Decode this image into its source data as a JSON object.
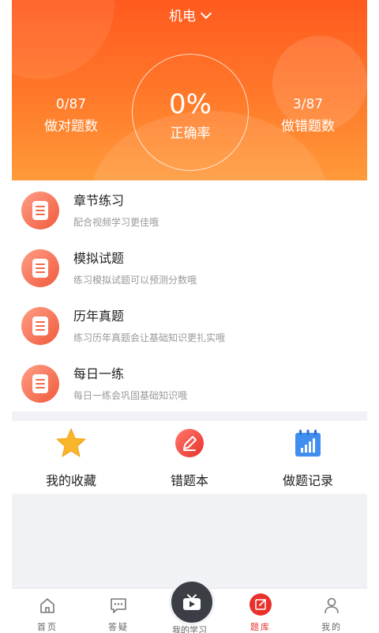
{
  "header": {
    "subject": "机电",
    "correct_count": "0/87",
    "correct_label": "做对题数",
    "accuracy_value": "0%",
    "accuracy_label": "正确率",
    "wrong_count": "3/87",
    "wrong_label": "做错题数"
  },
  "practice": {
    "items": [
      {
        "title": "章节练习",
        "subtitle": "配合视频学习更佳哦"
      },
      {
        "title": "模拟试题",
        "subtitle": "练习模拟试题可以预测分数哦"
      },
      {
        "title": "历年真题",
        "subtitle": "练习历年真题会让基础知识更扎实哦"
      },
      {
        "title": "每日一练",
        "subtitle": "每日一练会巩固基础知识哦"
      }
    ]
  },
  "tools": {
    "items": [
      {
        "label": "我的收藏",
        "icon": "star-icon"
      },
      {
        "label": "错题本",
        "icon": "pencil-icon"
      },
      {
        "label": "做题记录",
        "icon": "record-chart-icon"
      }
    ]
  },
  "tabbar": {
    "tabs": [
      {
        "label": "首页",
        "icon": "home-icon"
      },
      {
        "label": "答疑",
        "icon": "chat-icon"
      },
      {
        "label": "我的学习",
        "icon": "tv-play-icon"
      },
      {
        "label": "题库",
        "icon": "edit-icon",
        "active": true
      },
      {
        "label": "我的",
        "icon": "user-icon"
      }
    ]
  },
  "colors": {
    "accent": "#ff5a1f",
    "active_tab": "#e9302c",
    "icon_gradient_start": "#ff9e86",
    "icon_gradient_end": "#f05a3c"
  }
}
